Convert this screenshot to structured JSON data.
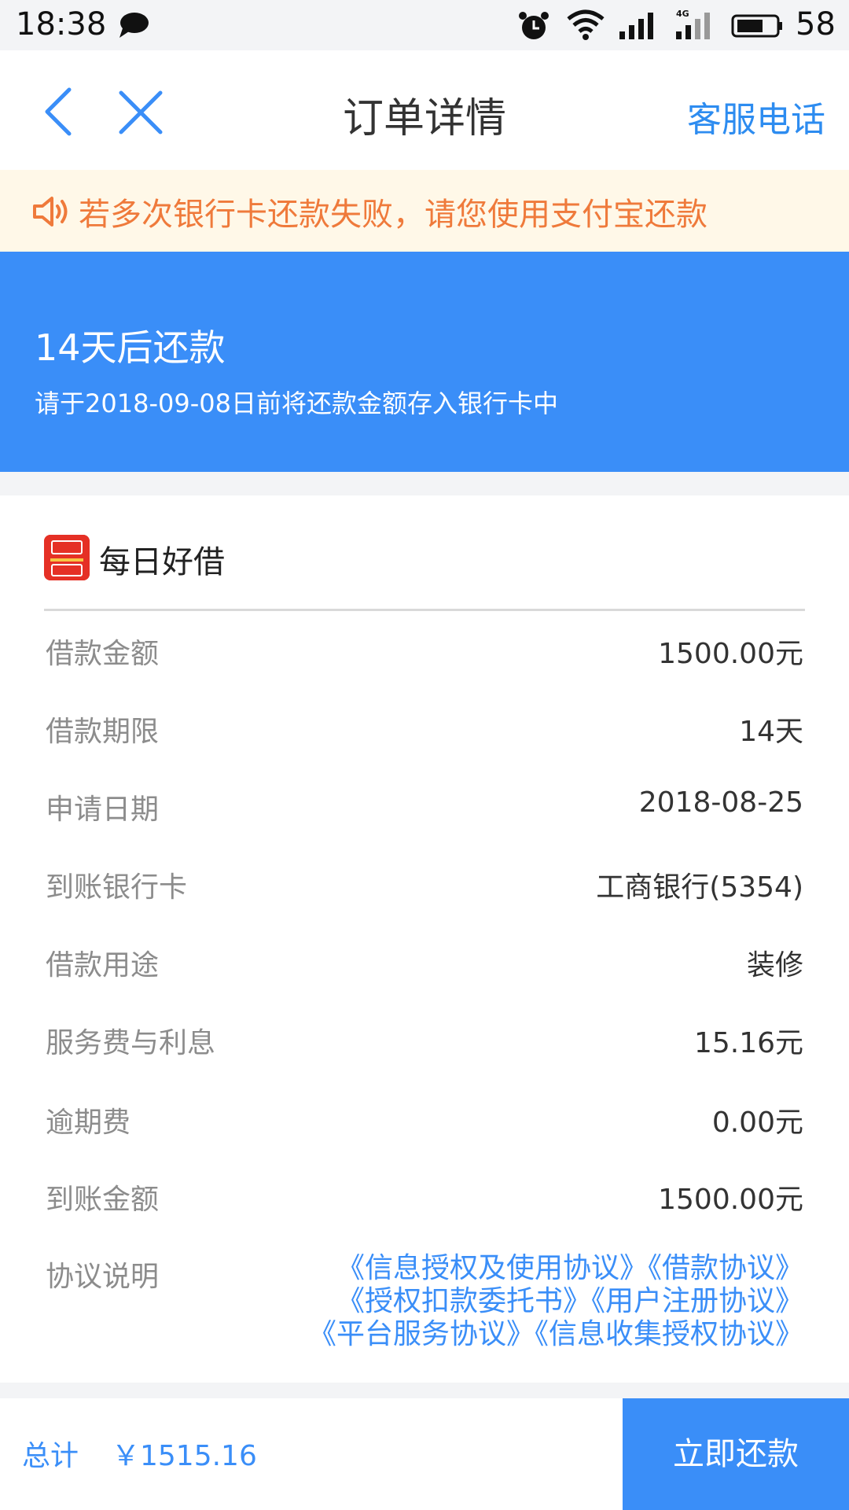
{
  "status_bar": {
    "time": "18:38",
    "battery": "58"
  },
  "nav": {
    "title": "订单详情",
    "service_link": "客服电话"
  },
  "notice": {
    "text": "若多次银行卡还款失败，请您使用支付宝还款"
  },
  "banner": {
    "title": "14天后还款",
    "subtitle": "请于2018-09-08日前将还款金额存入银行卡中"
  },
  "brand": {
    "name": "每日好借"
  },
  "details": [
    {
      "label": "借款金额",
      "value": "1500.00元"
    },
    {
      "label": "借款期限",
      "value": "14天"
    },
    {
      "label": "申请日期",
      "value": "2018-08-25"
    },
    {
      "label": "到账银行卡",
      "value": "工商银行(5354)"
    },
    {
      "label": "借款用途",
      "value": "装修"
    },
    {
      "label": "服务费与利息",
      "value": "15.16元"
    },
    {
      "label": "逾期费",
      "value": "0.00元"
    },
    {
      "label": "到账金额",
      "value": "1500.00元"
    }
  ],
  "agreements": {
    "label": "协议说明",
    "items": [
      "《信息授权及使用协议》",
      "《借款协议》",
      "《授权扣款委托书》",
      "《用户注册协议》",
      "《平台服务协议》",
      "《信息收集授权协议》"
    ]
  },
  "footer": {
    "total_label": "总计",
    "total_amount": "￥1515.16",
    "pay_button": "立即还款"
  },
  "colors": {
    "primary": "#3a8ef8",
    "notice_text": "#ef7a3b",
    "notice_bg": "#fff8e8",
    "brand_red": "#e53025"
  }
}
